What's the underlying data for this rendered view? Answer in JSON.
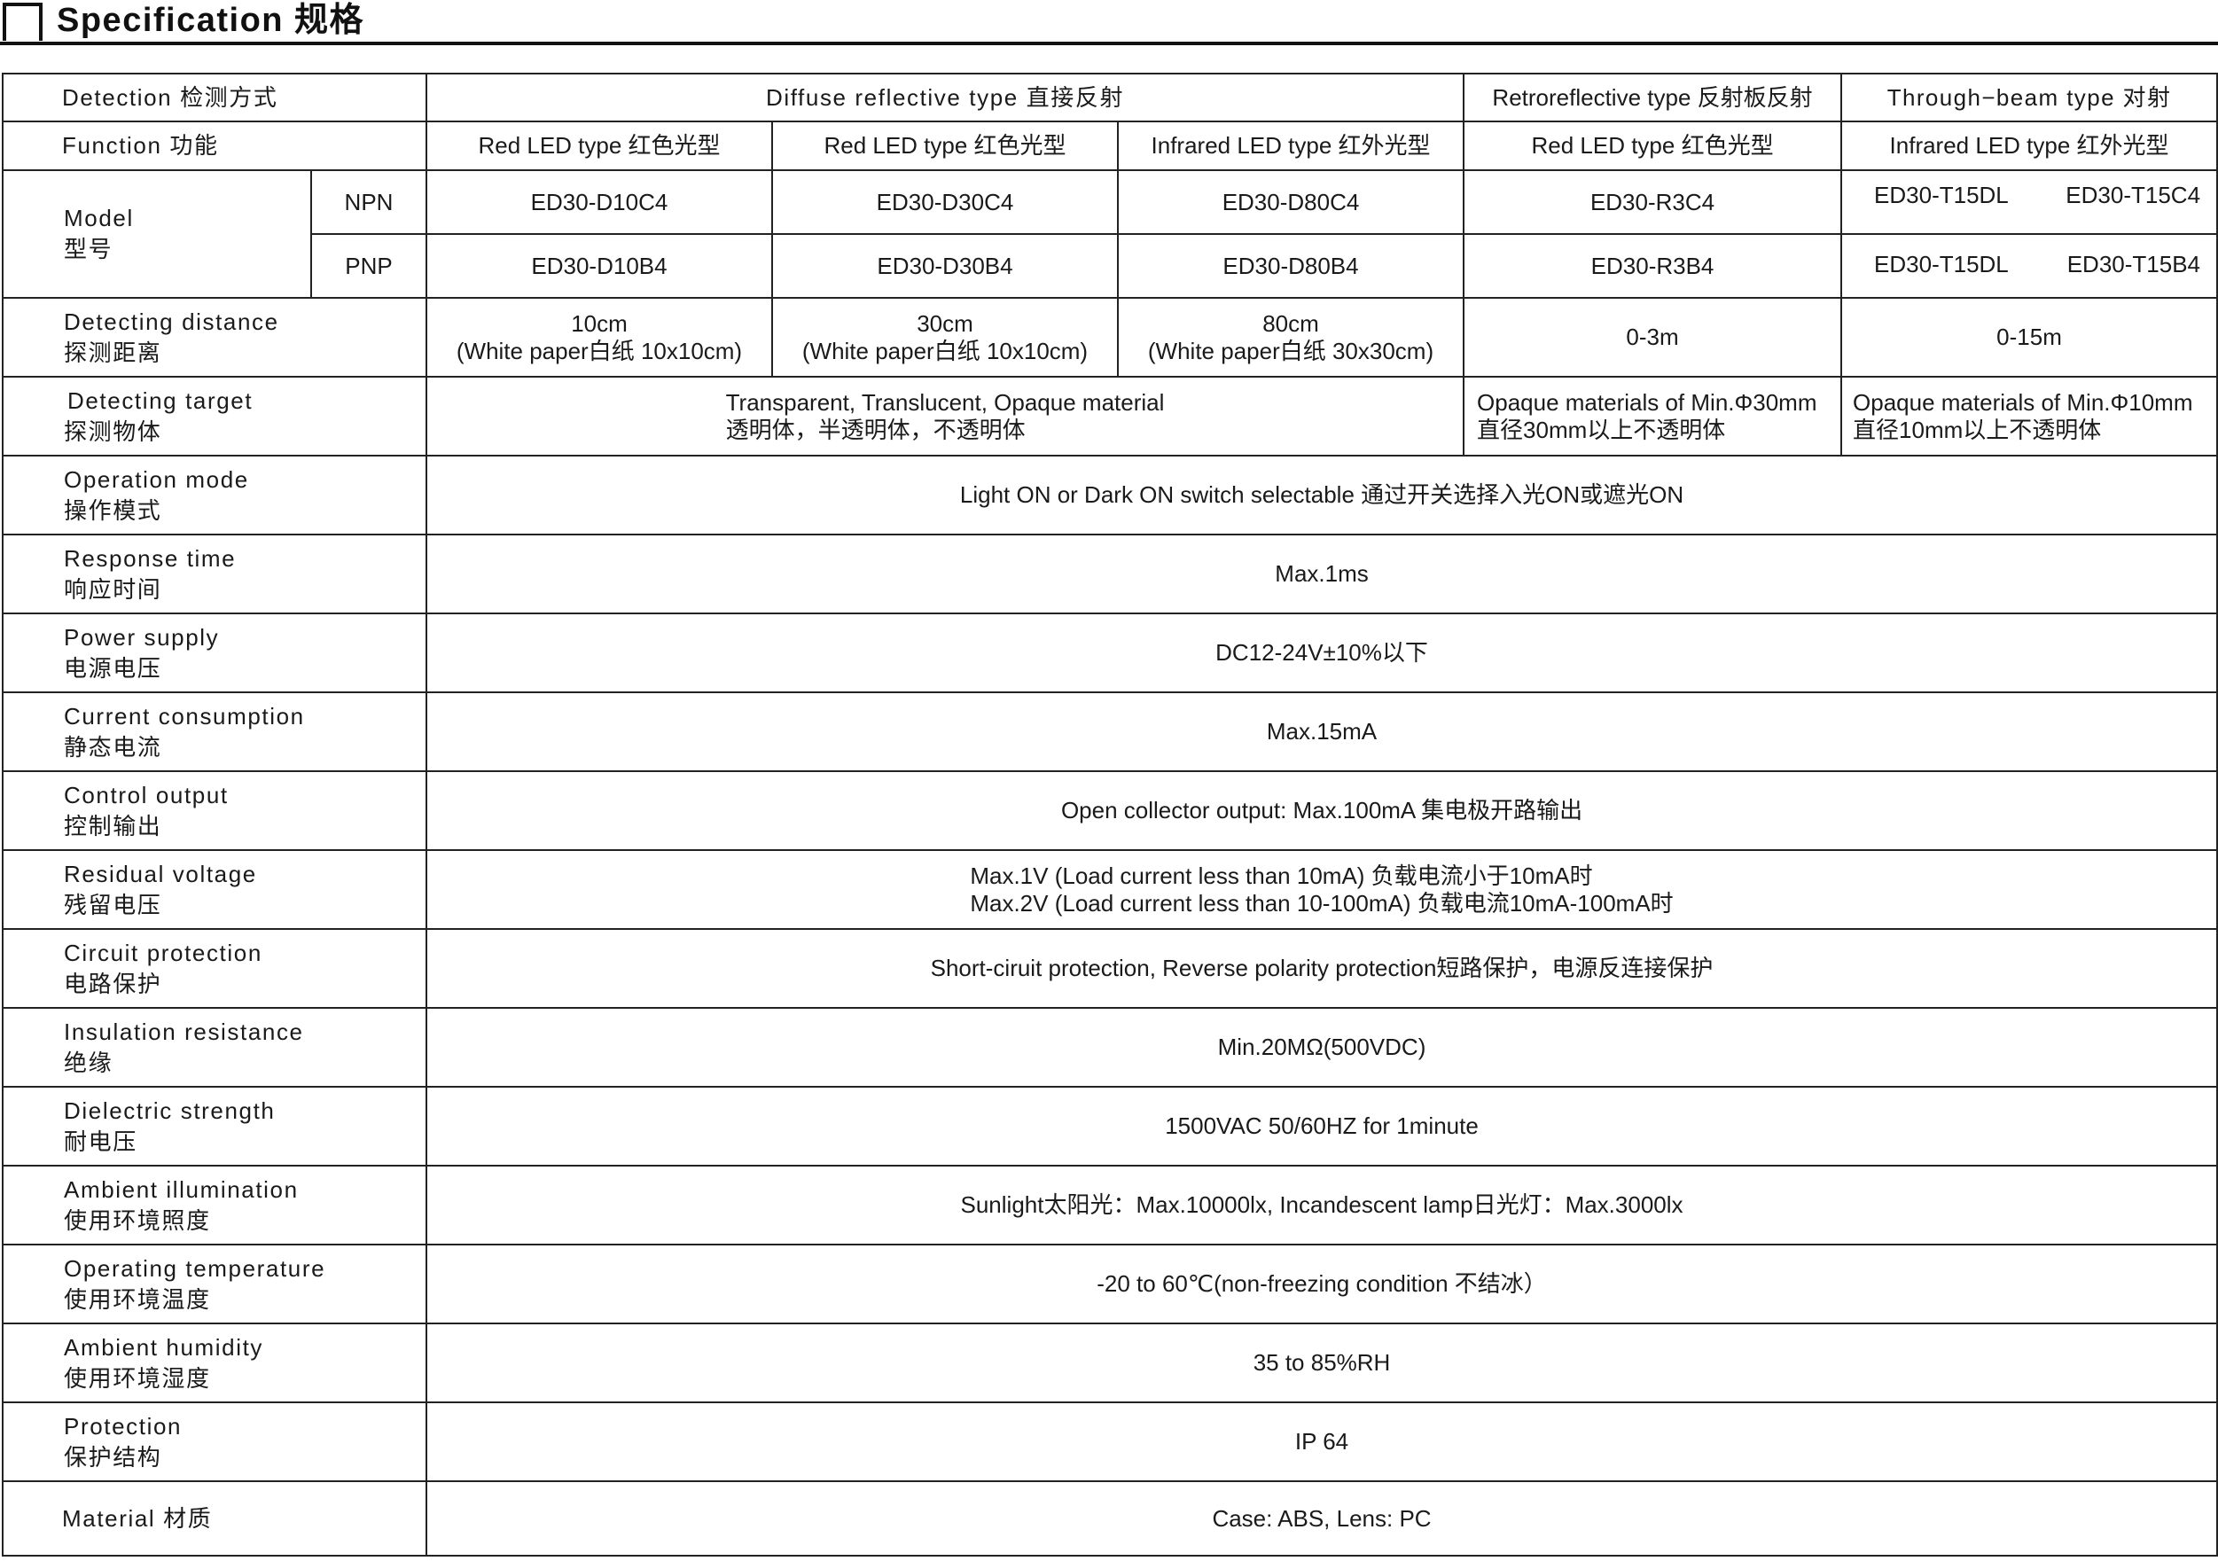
{
  "page": {
    "title": "Specification 规格"
  },
  "table": {
    "detection_label": "Detection 检测方式",
    "diffuse_header": "Diffuse reflective type  直接反射",
    "retro_header": "Retroreflective type 反射板反射",
    "through_header": "Through−beam type  对射",
    "function_label": "Function 功能",
    "functions": [
      "Red LED type 红色光型",
      "Red LED type 红色光型",
      "Infrared LED type 红外光型",
      "Red LED type 红色光型",
      "Infrared LED type 红外光型"
    ],
    "model_label_en": "Model",
    "model_label_cn": "型号",
    "npn_label": "NPN",
    "pnp_label": "PNP",
    "npn_models": [
      "ED30-D10C4",
      "ED30-D30C4",
      "ED30-D80C4",
      "ED30-R3C4",
      "ED30-T15DL",
      "ED30-T15C4"
    ],
    "pnp_models": [
      "ED30-D10B4",
      "ED30-D30B4",
      "ED30-D80B4",
      "ED30-R3B4",
      "ED30-T15DL",
      "ED30-T15B4"
    ],
    "distance_label_en": "Detecting distance",
    "distance_label_cn": "探测距离",
    "distances": [
      {
        "a": "10cm",
        "b": "(White paper白纸 10x10cm)"
      },
      {
        "a": "30cm",
        "b": "(White paper白纸 10x10cm)"
      },
      {
        "a": "80cm",
        "b": "(White paper白纸 30x30cm)"
      },
      {
        "a": "0-3m"
      },
      {
        "a": "0-15m"
      }
    ],
    "target_label_en": "Detecting target",
    "target_label_cn": "探测物体",
    "target_diffuse_1": "Transparent, Translucent, Opaque material",
    "target_diffuse_2": "透明体，半透明体，不透明体",
    "target_retro_1": "Opaque materials of Min.Φ30mm",
    "target_retro_2": "直径30mm以上不透明体",
    "target_through_1": "Opaque materials of Min.Φ10mm",
    "target_through_2": "直径10mm以上不透明体",
    "rows": [
      {
        "en": "Operation mode",
        "cn": "操作模式",
        "value": "Light ON or Dark ON switch selectable  通过开关选择入光ON或遮光ON"
      },
      {
        "en": "Response time",
        "cn": "响应时间",
        "value": "Max.1ms"
      },
      {
        "en": "Power supply",
        "cn": "电源电压",
        "value": "DC12-24V±10%以下"
      },
      {
        "en": "Current consumption",
        "cn": "静态电流",
        "value": "Max.15mA"
      },
      {
        "en": "Control output",
        "cn": "控制输出",
        "value": "Open collector output: Max.100mA  集电极开路输出"
      }
    ],
    "residual_label_en": "Residual voltage",
    "residual_label_cn": "残留电压",
    "residual_1": "Max.1V  (Load current less than 10mA)  负载电流小于10mA时",
    "residual_2": "Max.2V  (Load current less than 10-100mA)  负载电流10mA-100mA时",
    "rows2": [
      {
        "en": "Circuit protection",
        "cn": "电路保护",
        "value": "Short-ciruit protection, Reverse polarity protection短路保护，电源反连接保护"
      },
      {
        "en": "Insulation resistance",
        "cn": "绝缘",
        "value": "Min.20MΩ(500VDC)"
      },
      {
        "en": "Dielectric strength",
        "cn": "耐电压",
        "value": "1500VAC 50/60HZ for 1minute"
      },
      {
        "en": "Ambient illumination",
        "cn": "使用环境照度",
        "value": "Sunlight太阳光：Max.10000lx, Incandescent lamp日光灯：Max.3000lx"
      },
      {
        "en": "Operating temperature",
        "cn": "使用环境温度",
        "value": "-20 to 60℃(non-freezing condition 不结冰）"
      },
      {
        "en": "Ambient humidity",
        "cn": "使用环境湿度",
        "value": "35 to 85%RH"
      },
      {
        "en": "Protection",
        "cn": "保护结构",
        "value": "IP 64"
      }
    ],
    "material_label": "Material 材质",
    "material_value": "Case: ABS, Lens: PC"
  }
}
